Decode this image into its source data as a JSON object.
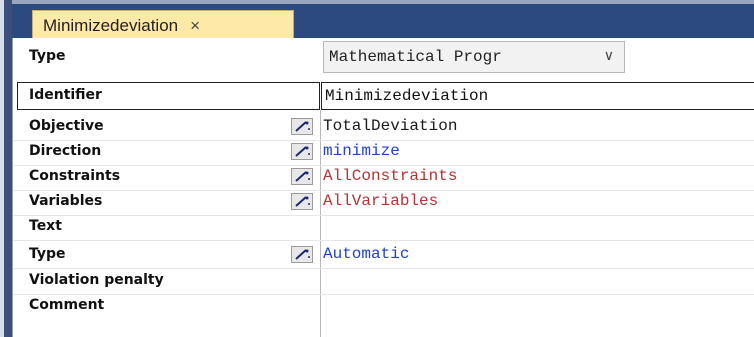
{
  "tab": {
    "title": "Minimizedeviation",
    "close_glyph": "×"
  },
  "type_row": {
    "label": "Type",
    "selected": "Mathematical Progr",
    "chevron": "∨"
  },
  "identifier_row": {
    "label": "Identifier",
    "value": "Minimizedeviation"
  },
  "rows": [
    {
      "label": "Objective",
      "value": "TotalDeviation",
      "has_wand": true,
      "value_color": "#1a1a1a"
    },
    {
      "label": "Direction",
      "value": "minimize",
      "has_wand": true,
      "value_color": "#1f3fd6"
    },
    {
      "label": "Constraints",
      "value": "AllConstraints",
      "has_wand": true,
      "value_color": "#b83232"
    },
    {
      "label": "Variables",
      "value": "AllVariables",
      "has_wand": true,
      "value_color": "#b83232"
    },
    {
      "label": "Text",
      "value": "",
      "has_wand": false,
      "value_color": "#1a1a1a"
    },
    {
      "label": "Type",
      "value": "Automatic",
      "has_wand": true,
      "value_color": "#1f3fd6"
    },
    {
      "label": "Violation penalty",
      "value": "",
      "has_wand": false,
      "value_color": "#1a1a1a"
    },
    {
      "label": "Comment",
      "value": "",
      "has_wand": false,
      "value_color": "#1a1a1a"
    }
  ],
  "icons": {
    "wand": "wizard-wand-icon"
  }
}
